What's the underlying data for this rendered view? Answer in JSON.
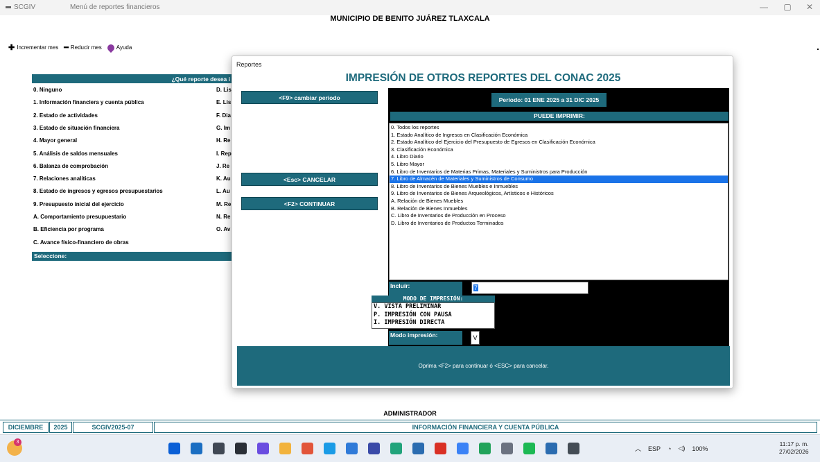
{
  "window": {
    "app_name": "SCGIV",
    "title": "Menú de reportes financieros",
    "controls": [
      "—",
      "▢",
      "✕"
    ]
  },
  "municipio": "MUNICIPIO DE BENITO JUÁREZ TLAXCALA",
  "toolbar": {
    "increment": "Incrementar mes",
    "decrement": "Reducir mes",
    "help": "Ayuda"
  },
  "menu": {
    "header": "¿Qué reporte desea i",
    "left": [
      "0. Ninguno",
      "1. Información financiera y cuenta pública",
      "2. Estado de actividades",
      "3. Estado de situación financiera",
      "4. Mayor general",
      "5. Análisis de saldos mensuales",
      "6. Balanza de comprobación",
      "7. Relaciones analíticas",
      "8. Estado de ingresos y egresos presupuestarios",
      "9. Presupuesto inicial del ejercicio",
      "A. Comportamiento presupuestario",
      "B. Eficiencia por programa",
      "C. Avance físico-financiero de obras"
    ],
    "right": [
      "D. Lis",
      "E. Lis",
      "F. Dia",
      "G. Im",
      "H. Re",
      "I. Rep",
      "J. Re",
      "K. Au",
      "L. Au",
      "M. Re",
      "N. Re",
      "O. Av"
    ],
    "select_label": "Seleccione:"
  },
  "dialog": {
    "title": "Reportes",
    "heading": "IMPRESIÓN DE OTROS REPORTES DEL CONAC 2025",
    "btn_period": "<F9> cambiar periodo",
    "btn_cancel": "<Esc> CANCELAR",
    "btn_continue": "<F2> CONTINUAR",
    "period": "Periodo: 01 ENE 2025 a 31 DIC 2025",
    "can_print": "PUEDE IMPRIMIR:",
    "reports": [
      "0. Todos los reportes",
      "1. Estado Analítico de Ingresos en Clasificación Económica",
      "2. Estado Analítico del Ejercicio del Presupuesto de Egresos en Clasificación Económica",
      "3. Clasificación Económica",
      "4. Libro Diario",
      "5. Libro Mayor",
      "6. Libro de Inventarios de Materias Primas, Materiales y Suministros para Producción",
      "7. Libro de Almacén de Materiales y Suministros de Consumo",
      "8. Libro de Inventarios de Bienes Muebles e Inmuebles",
      "9. Libro de Inventarios de Bienes Arqueológicos, Artísticos e Históricos",
      "A. Relación de Bienes Muebles",
      "B. Relación de Bienes Inmuebles",
      "C. Libro de Inventarios de Producción en Proceso",
      "D. Libro de Inventarios de Productos Terminados"
    ],
    "selected_index": 7,
    "include_label": "Incluír:",
    "include_value": "7",
    "print_mode_header": "MODO DE IMPRESIÓN:",
    "print_modes": [
      "V. VISTA PRELIMINAR",
      "P. IMPRESIÓN CON PAUSA",
      "I. IMPRESIÓN DIRECTA"
    ],
    "mode_label": "Modo impresión:",
    "mode_value": "V",
    "footer": "Oprima <F2> para continuar ó <ESC> para cancelar."
  },
  "user": "ADMINISTRADOR",
  "status": {
    "month": "DICIEMBRE",
    "year": "2025",
    "version": "SCGIV2025-07",
    "report": "INFORMACIÓN FINANCIERA Y CUENTA PÚBLICA"
  },
  "taskbar": {
    "weather_badge": "3",
    "language": "ESP",
    "battery": "100%",
    "time": "11:17 p. m.",
    "date": "27/02/2026",
    "icon_colors": [
      "#0a5fd6",
      "#1b6ec2",
      "#404854",
      "#2a2f37",
      "#6a4de0",
      "#f2b33d",
      "#e2553a",
      "#1a9be6",
      "#2f7ad8",
      "#3a4aa8",
      "#21a37b",
      "#2b6cb0",
      "#d93025",
      "#3b82f6",
      "#22a35b",
      "#6b7280",
      "#1db954",
      "#2b6cb0",
      "#444c55"
    ]
  }
}
